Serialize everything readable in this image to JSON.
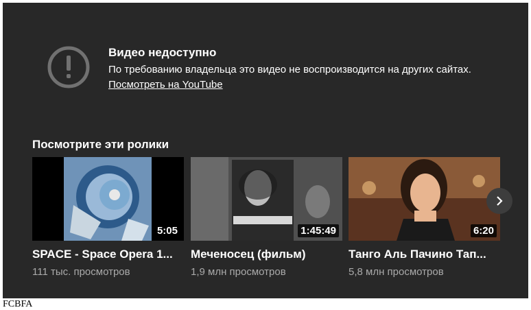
{
  "error": {
    "title": "Видео недоступно",
    "message": "По требованию владельца это видео не воспроизводится на других сайтах.",
    "link": "Посмотреть на YouTube",
    "icon": "alert-circle-icon"
  },
  "suggestions": {
    "heading": "Посмотрите эти ролики",
    "videos": [
      {
        "title": "SPACE - Space Opera 1...",
        "views": "111 тыс. просмотров",
        "duration": "5:05"
      },
      {
        "title": "Меченосец (фильм)",
        "views": "1,9 млн просмотров",
        "duration": "1:45:49"
      },
      {
        "title": "Танго Аль Пачино Тап...",
        "views": "5,8 млн просмотров",
        "duration": "6:20"
      }
    ],
    "next_icon": "chevron-right-icon"
  },
  "footer": {
    "text": "FCBFA"
  },
  "colors": {
    "player_bg": "#282828",
    "secondary_text": "#aaaaaa",
    "icon_gray": "#717171"
  }
}
